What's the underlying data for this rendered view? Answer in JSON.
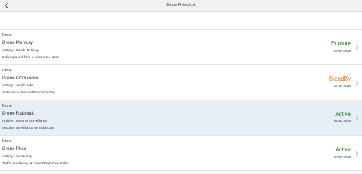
{
  "header": {
    "title": "Drone Flying List"
  },
  "items": [
    {
      "type": "Drone",
      "title": "Drone Mercury",
      "activity": "Activity : Goods Delivery",
      "description": "Deliver parcel from e-commerce store",
      "status": "Enroute",
      "status_color": "#2b7d2b",
      "date": "26-08-2018"
    },
    {
      "type": "Drone",
      "title": "Drone Ambulance",
      "activity": "Activity : Health Aids",
      "description": "Ambulance from AIIMS on Standby",
      "status": "StandBy",
      "status_color": "#e9730c",
      "date": "26-08-2018"
    },
    {
      "type": "Drone",
      "title": "Drone Rakshak",
      "activity": "Activity : Security Surveillance",
      "description": "Security surveillance on India Gate",
      "status": "Active",
      "status_color": "#2b7d2b",
      "date": "26-08-2018"
    },
    {
      "type": "Drone",
      "title": "Drone Pluto",
      "activity": "Activity : Monitoring",
      "description": "Traffic monitoring at Akbar Road, New Delhi",
      "status": "Active",
      "status_color": "#2b7d2b",
      "date": "26-08-2018"
    }
  ],
  "icons": {
    "back": "chevron-left-icon",
    "navigate": "chevron-right-icon"
  }
}
